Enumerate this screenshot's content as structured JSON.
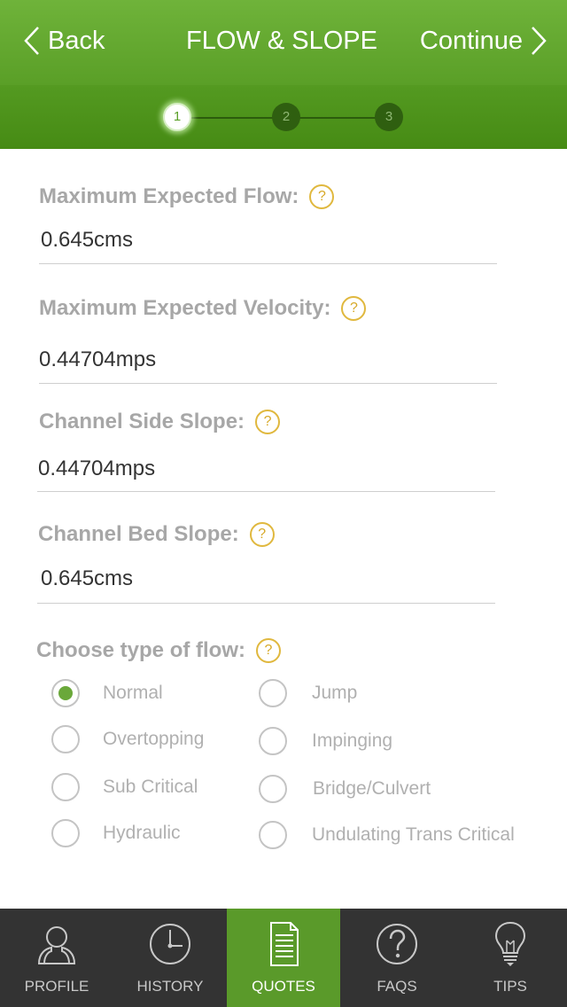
{
  "header": {
    "back_label": "Back",
    "title": "FLOW & SLOPE",
    "continue_label": "Continue"
  },
  "stepper": {
    "steps": [
      "1",
      "2",
      "3"
    ],
    "active_step": "1"
  },
  "form": {
    "fields": [
      {
        "label": "Maximum Expected Flow:",
        "value": "0.645cms"
      },
      {
        "label": "Maximum Expected Velocity:",
        "value": "0.44704mps"
      },
      {
        "label": "Channel Side Slope:",
        "value": "0.44704mps"
      },
      {
        "label": "Channel Bed Slope:",
        "value": "0.645cms"
      }
    ],
    "help_glyph": "?",
    "flow_type_label": "Choose type of flow:",
    "flow_types": [
      {
        "label": "Normal",
        "checked": true
      },
      {
        "label": "Jump",
        "checked": false
      },
      {
        "label": "Overtopping",
        "checked": false
      },
      {
        "label": "Impinging",
        "checked": false
      },
      {
        "label": "Sub Critical",
        "checked": false
      },
      {
        "label": "Bridge/Culvert",
        "checked": false
      },
      {
        "label": "Hydraulic",
        "checked": false
      },
      {
        "label": "Undulating Trans Critical",
        "checked": false
      }
    ]
  },
  "tabbar": {
    "tabs": [
      {
        "label": "PROFILE",
        "icon": "person-icon"
      },
      {
        "label": "HISTORY",
        "icon": "clock-icon"
      },
      {
        "label": "QUOTES",
        "icon": "document-icon"
      },
      {
        "label": "FAQS",
        "icon": "question-icon"
      },
      {
        "label": "TIPS",
        "icon": "lightbulb-icon"
      }
    ],
    "active_tab": "QUOTES"
  },
  "colors": {
    "header_green": "#5a9f27",
    "active_tab_green": "#5a9a2a",
    "help_yellow": "#d7a928",
    "tabbar_bg": "#333333"
  }
}
